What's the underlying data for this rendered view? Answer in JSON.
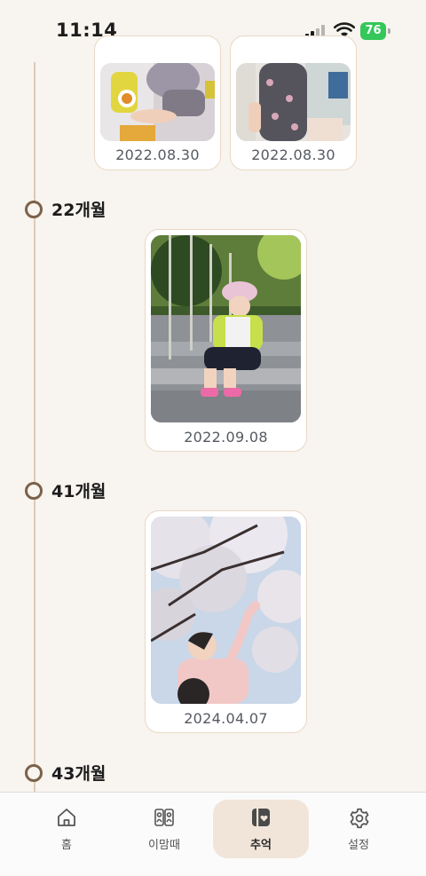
{
  "status_bar": {
    "time": "11:14",
    "battery_percent": "76"
  },
  "timeline": {
    "top_photos": [
      {
        "date": "2022.08.30"
      },
      {
        "date": "2022.08.30"
      }
    ],
    "groups": [
      {
        "label": "22개월",
        "date": "2022.09.08"
      },
      {
        "label": "41개월",
        "date": "2024.04.07"
      },
      {
        "label": "43개월"
      }
    ]
  },
  "tab_bar": {
    "active_tab": "추억",
    "tabs": [
      {
        "label": "홈",
        "icon": "home-icon"
      },
      {
        "label": "이맘때",
        "icon": "then-and-now-icon"
      },
      {
        "label": "추억",
        "icon": "memory-album-icon"
      },
      {
        "label": "설정",
        "icon": "gear-icon"
      }
    ]
  },
  "colors": {
    "background": "#f8f4ef",
    "timeline": "#ddcbb6",
    "marker": "#7d6149",
    "active_tab": "#f1e5da",
    "battery": "#34c759"
  }
}
